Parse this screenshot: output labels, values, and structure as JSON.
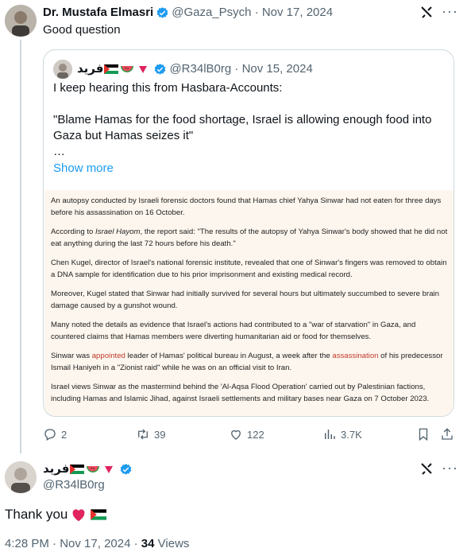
{
  "main_tweet": {
    "author_name": "Dr. Mustafa Elmasri",
    "handle": "@Gaza_Psych",
    "date": "Nov 17, 2024",
    "text": "Good question"
  },
  "quote": {
    "author_name": "فريد",
    "handle": "@R34lB0rg",
    "date": "Nov 15, 2024",
    "line1": "I keep hearing this from Hasbara-Accounts:",
    "line2": "\"Blame Hamas for the food shortage, Israel is allowing enough food into Gaza but Hamas seizes it\"",
    "line3": "…",
    "show_more": "Show more",
    "article": {
      "p1": "An autopsy conducted by Israeli forensic doctors found that Hamas chief Yahya Sinwar had not eaten for three days before his assassination on 16 October.",
      "p2a": "According to ",
      "p2b": "Israel Hayom",
      "p2c": ", the report said: \"The results of the autopsy of Yahya Sinwar's body showed that he did not eat anything during the last 72 hours before his death.\"",
      "p3": "Chen Kugel, director of Israel's national forensic institute, revealed that one of Sinwar's fingers was removed to obtain a DNA sample for identification due to his prior imprisonment and existing medical record.",
      "p4": "Moreover, Kugel stated that Sinwar had initially survived for several hours but ultimately succumbed to severe brain damage caused by a gunshot wound.",
      "p5": "Many noted the details as evidence that Israel's actions had contributed to a \"war of starvation\" in Gaza, and countered claims that Hamas members were diverting humanitarian aid or food for themselves.",
      "p6a": "Sinwar was ",
      "p6b": "appointed",
      "p6c": " leader of Hamas' political bureau in August, a week after the ",
      "p6d": "assassination",
      "p6e": " of his predecessor Ismail Haniyeh in a \"Zionist raid\" while he was on an official visit to Iran.",
      "p7": "Israel views Sinwar as the mastermind behind the 'Al-Aqsa Flood Operation' carried out by Palestinian factions, including Hamas and Islamic Jihad, against Israeli settlements and military bases near Gaza on 7 October 2023."
    }
  },
  "actions": {
    "replies": "2",
    "retweets": "39",
    "likes": "122",
    "views": "3.7K"
  },
  "reply_tweet": {
    "author_name": "فريد",
    "handle": "@R34lB0rg",
    "text": "Thank you",
    "time": "4:28 PM",
    "date": "Nov 17, 2024",
    "views_count": "34",
    "views_label": "Views"
  },
  "colors": {
    "accent": "#1d9bf0",
    "muted": "#536471",
    "article_bg": "#fdf6ee",
    "link_red": "#c0392b",
    "heart": "#e0245e"
  },
  "icons": [
    "grok-icon",
    "more-icon",
    "verified-icon",
    "reply-icon",
    "retweet-icon",
    "like-icon",
    "views-icon",
    "bookmark-icon",
    "share-icon",
    "palestine-flag-icon",
    "watermelon-icon",
    "red-triangle-icon",
    "heart-icon"
  ]
}
